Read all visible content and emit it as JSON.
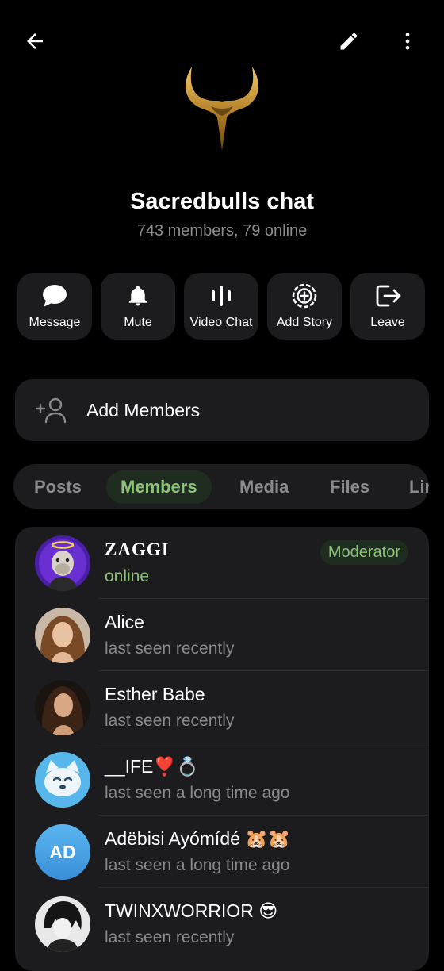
{
  "header": {
    "back_icon": "back-arrow-icon",
    "edit_icon": "pencil-icon",
    "more_icon": "more-vertical-icon"
  },
  "group": {
    "title": "Sacredbulls chat",
    "subtitle": "743 members, 79 online"
  },
  "actions": [
    {
      "label": "Message",
      "icon": "message-icon"
    },
    {
      "label": "Mute",
      "icon": "bell-icon"
    },
    {
      "label": "Video Chat",
      "icon": "voice-bars-icon"
    },
    {
      "label": "Add Story",
      "icon": "add-story-icon"
    },
    {
      "label": "Leave",
      "icon": "leave-icon"
    }
  ],
  "add_members": {
    "label": "Add Members",
    "icon": "add-person-icon"
  },
  "tabs": [
    {
      "label": "Posts",
      "active": false
    },
    {
      "label": "Members",
      "active": true
    },
    {
      "label": "Media",
      "active": false
    },
    {
      "label": "Files",
      "active": false
    },
    {
      "label": "Lin",
      "active": false
    }
  ],
  "members": [
    {
      "name": "ZAGGI",
      "status": "online",
      "badge": "Moderator"
    },
    {
      "name": "Alice",
      "status": "last seen recently"
    },
    {
      "name": "Esther Babe",
      "status": "last seen recently"
    },
    {
      "name": "__IFE❣️💍",
      "status": "last seen a long time ago"
    },
    {
      "name": "Adëbisi Ayómídé 🐹🐹",
      "status": "last seen a long time ago",
      "initials": "AD"
    },
    {
      "name": "TWINXWORRIOR 😎",
      "status": "last seen recently"
    }
  ],
  "colors": {
    "accent_green": "#8dc27a",
    "card_bg": "#1c1c1e",
    "muted_text": "#8a8a8e"
  }
}
